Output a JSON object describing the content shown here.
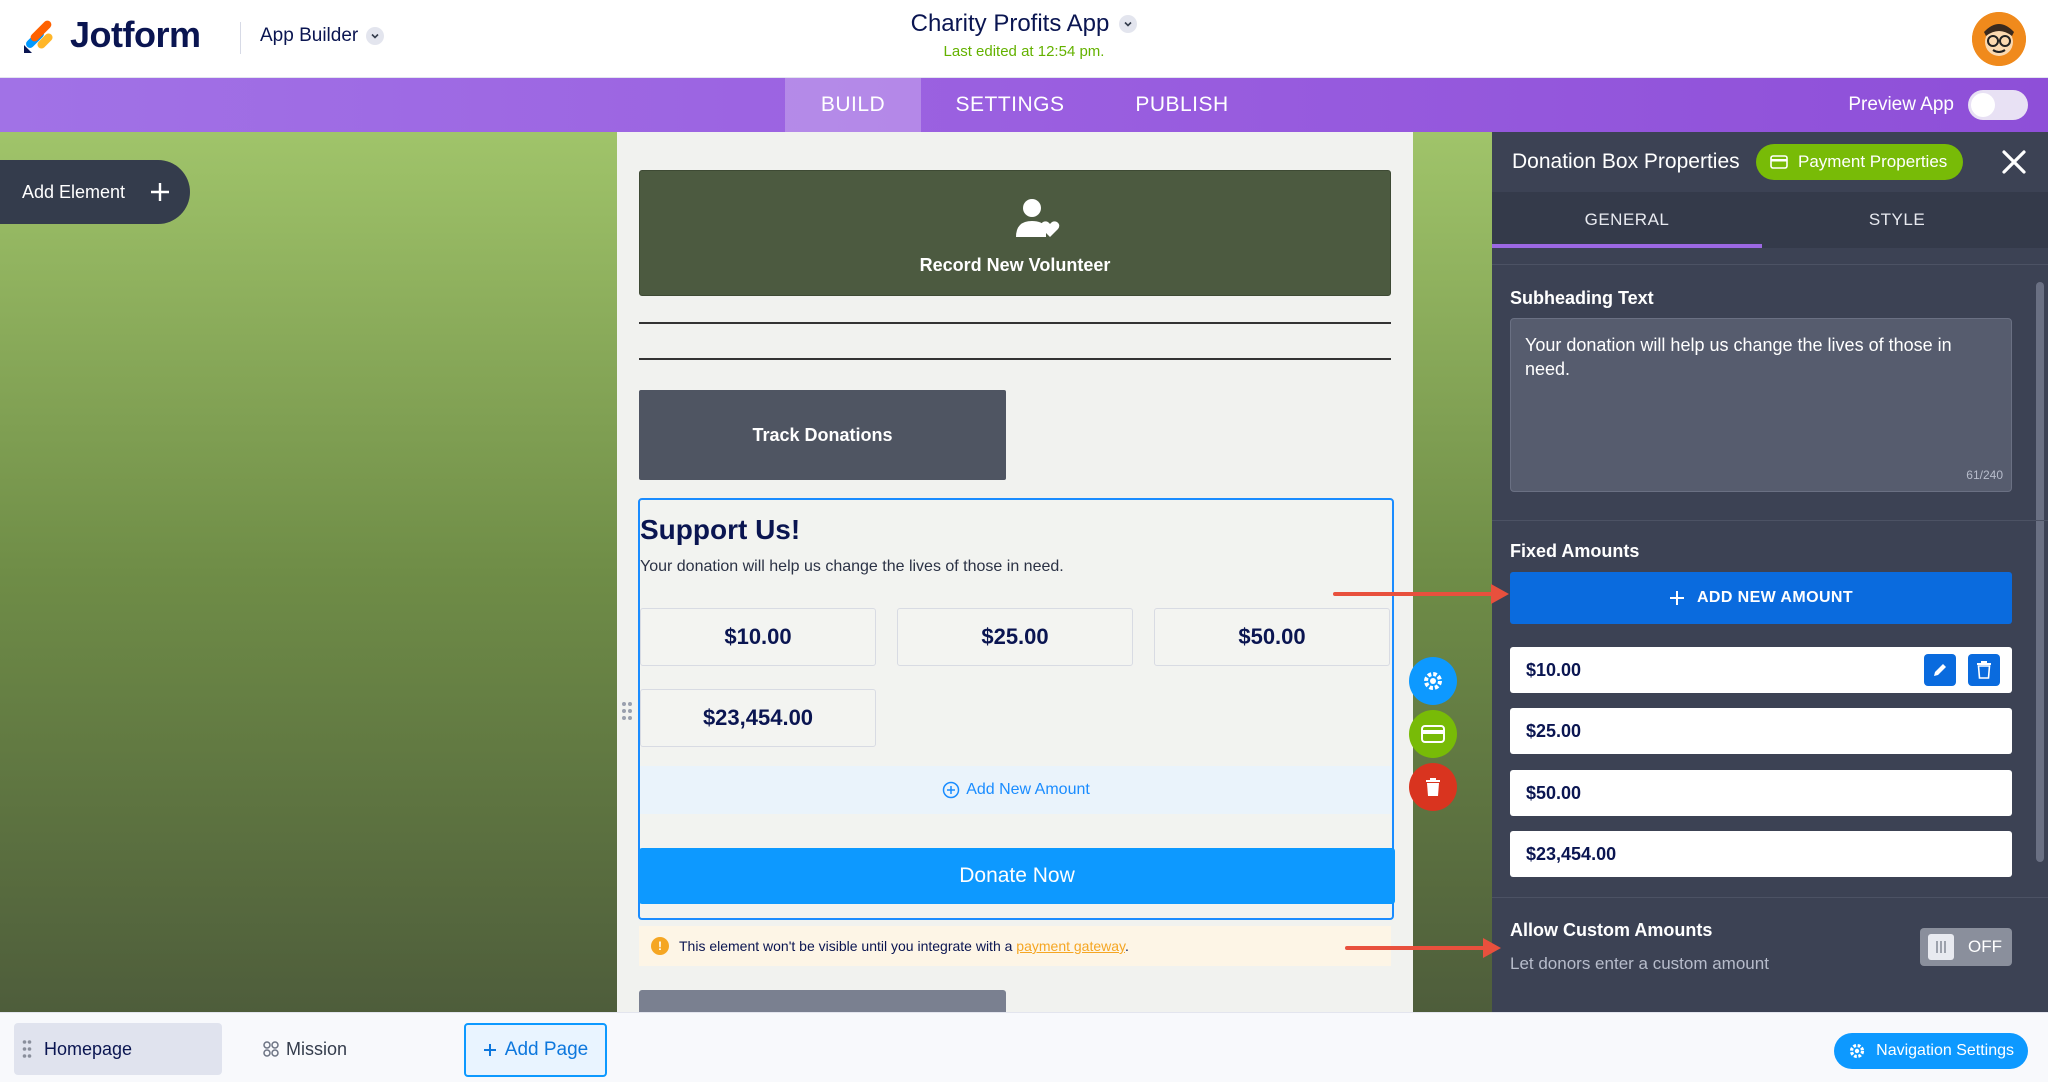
{
  "header": {
    "brand": "Jotform",
    "product": "App Builder",
    "app_title": "Charity Profits App",
    "last_edited": "Last edited at 12:54 pm."
  },
  "nav": {
    "tabs": [
      {
        "label": "BUILD",
        "active": true
      },
      {
        "label": "SETTINGS",
        "active": false
      },
      {
        "label": "PUBLISH",
        "active": false
      }
    ],
    "preview_label": "Preview App",
    "preview_on": false
  },
  "canvas": {
    "add_element_label": "Add Element",
    "volunteer_button": "Record New Volunteer",
    "track_button": "Track Donations",
    "donation_box": {
      "title": "Support Us!",
      "subheading": "Your donation will help us change the lives of those in need.",
      "amounts": [
        "$10.00",
        "$25.00",
        "$50.00",
        "$23,454.00"
      ],
      "add_amount_label": "Add New Amount",
      "donate_label": "Donate Now"
    },
    "warning": {
      "text_before": "This element won't be visible until you integrate with a",
      "link": "payment gateway",
      "text_after": "."
    }
  },
  "panel": {
    "title": "Donation Box Properties",
    "payment_badge": "Payment Properties",
    "tabs": [
      {
        "label": "GENERAL",
        "active": true
      },
      {
        "label": "STYLE",
        "active": false
      }
    ],
    "subheading_label": "Subheading Text",
    "subheading_value": "Your donation will help us change the lives of those in need.",
    "char_counter": "61/240",
    "fixed_amounts_label": "Fixed Amounts",
    "add_new_amount_label": "ADD NEW AMOUNT",
    "amount_rows": [
      "$10.00",
      "$25.00",
      "$50.00",
      "$23,454.00"
    ],
    "custom_amounts_label": "Allow Custom Amounts",
    "custom_amounts_desc": "Let donors enter a custom amount",
    "custom_amounts_state": "OFF"
  },
  "bottombar": {
    "pages": [
      {
        "label": "Homepage",
        "active": true
      },
      {
        "label": "Mission",
        "active": false
      }
    ],
    "add_page_label": "Add Page",
    "nav_settings_label": "Navigation Settings"
  },
  "colors": {
    "brand_purple": "#9a5fe0",
    "accent_blue": "#0d99ff",
    "payment_green": "#78bb07",
    "danger_red": "#e8503d",
    "panel_bg": "#3c4254"
  }
}
